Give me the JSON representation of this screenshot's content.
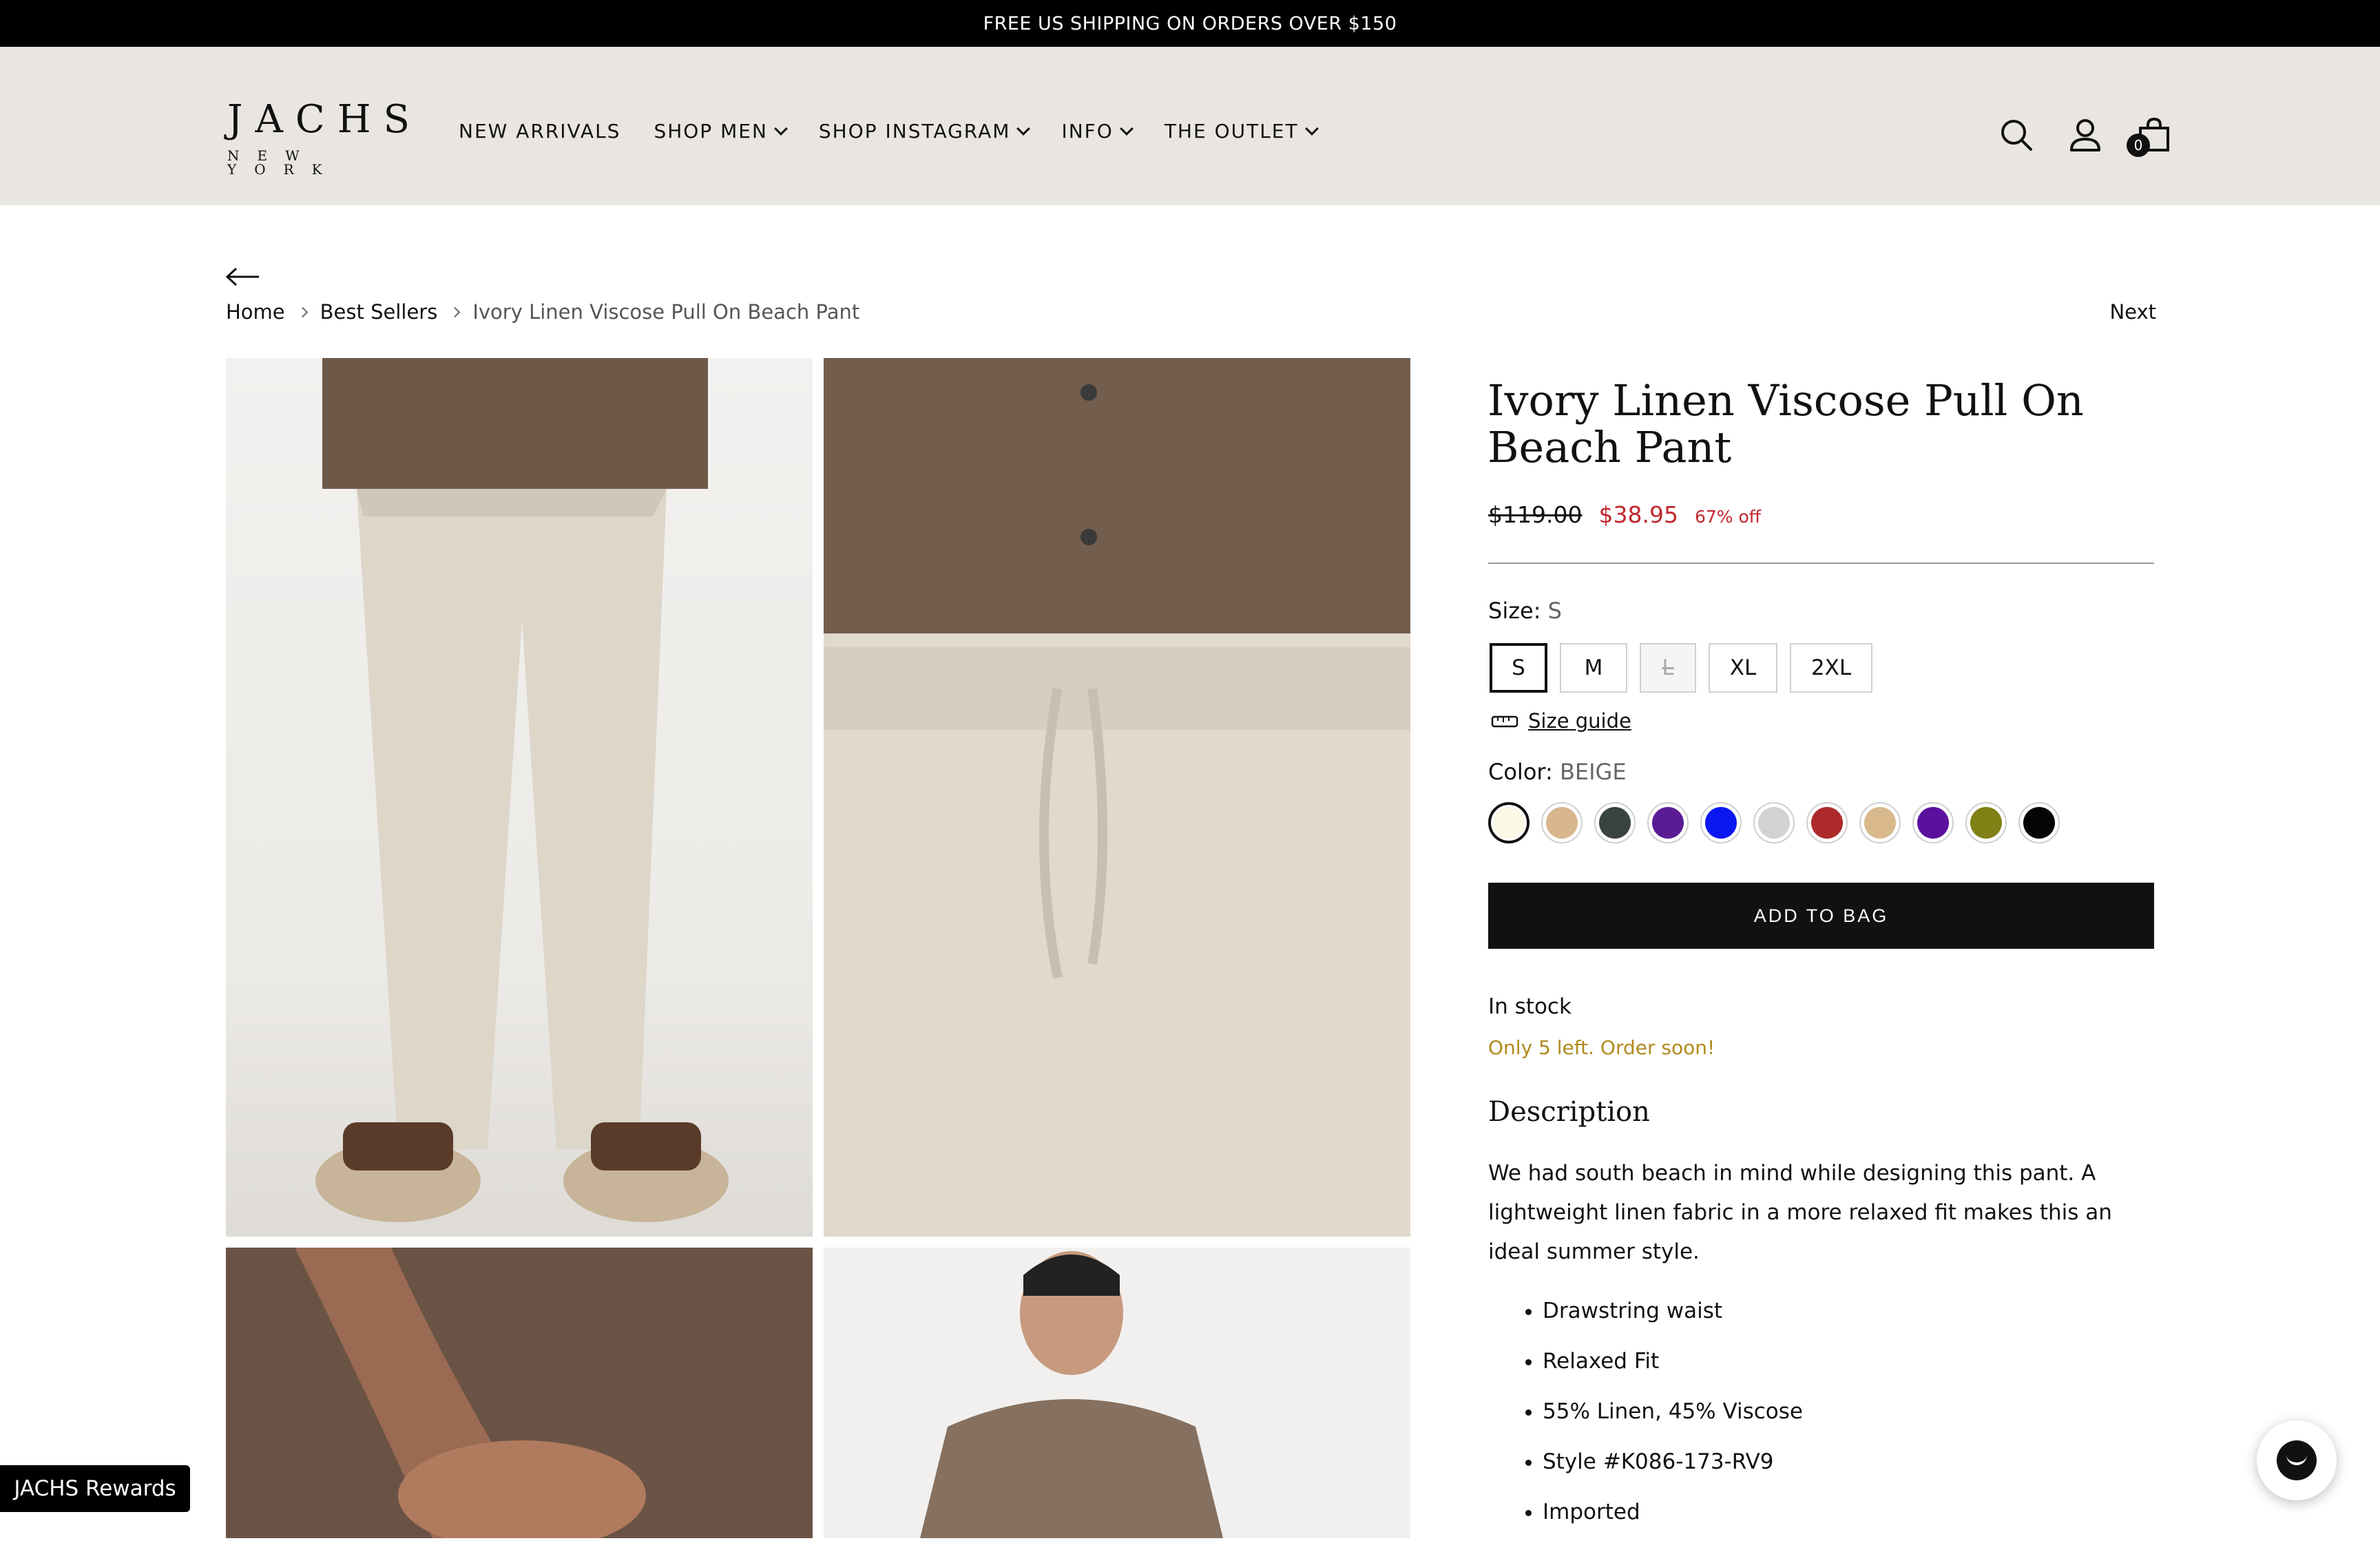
{
  "announcement": "FREE US SHIPPING ON ORDERS OVER $150",
  "header": {
    "logo_main": "JACHS",
    "logo_sub": "NEW YORK",
    "nav": [
      {
        "label": "NEW ARRIVALS",
        "dropdown": false
      },
      {
        "label": "SHOP MEN",
        "dropdown": true
      },
      {
        "label": "SHOP INSTAGRAM",
        "dropdown": true
      },
      {
        "label": "INFO",
        "dropdown": true
      },
      {
        "label": "THE OUTLET",
        "dropdown": true
      }
    ],
    "icons": [
      "search-icon",
      "account-icon",
      "bag-icon"
    ],
    "cart_count": "0"
  },
  "breadcrumb": {
    "items": [
      "Home",
      "Best Sellers"
    ],
    "current": "Ivory Linen Viscose Pull On Beach Pant"
  },
  "next_label": "Next",
  "product": {
    "title": "Ivory Linen Viscose Pull On Beach Pant",
    "compare_price": "$119.00",
    "price": "$38.95",
    "discount": "67% off",
    "size_label": "Size:",
    "size_value": "S",
    "sizes": [
      {
        "label": "S",
        "selected": true,
        "available": true
      },
      {
        "label": "M",
        "selected": false,
        "available": true
      },
      {
        "label": "L",
        "selected": false,
        "available": false
      },
      {
        "label": "XL",
        "selected": false,
        "available": true
      },
      {
        "label": "2XL",
        "selected": false,
        "available": true
      }
    ],
    "size_guide": "Size guide",
    "color_label": "Color:",
    "color_value": "BEIGE",
    "colors": [
      "#fbf8e6",
      "#d8b68e",
      "#394341",
      "#5a1c94",
      "#0a17f0",
      "#d2d2d2",
      "#ad2a2a",
      "#d9b98c",
      "#5b109e",
      "#808015",
      "#050505"
    ],
    "add_to_bag": "ADD TO BAG",
    "stock": "In stock",
    "urgency": "Only 5 left. Order soon!",
    "description_heading": "Description",
    "description": "We had south beach in mind while designing this pant. A lightweight linen fabric in a more relaxed fit makes this an ideal summer style.",
    "bullets": [
      "Drawstring waist",
      "Relaxed Fit",
      "55% Linen, 45% Viscose",
      "Style #K086-173-RV9",
      "Imported"
    ]
  },
  "rewards_label": "JACHS Rewards",
  "colors": {
    "sale": "#c2262e",
    "urgency": "#b08a1d",
    "header_bg": "#e9e6e2",
    "button": "#111111"
  }
}
